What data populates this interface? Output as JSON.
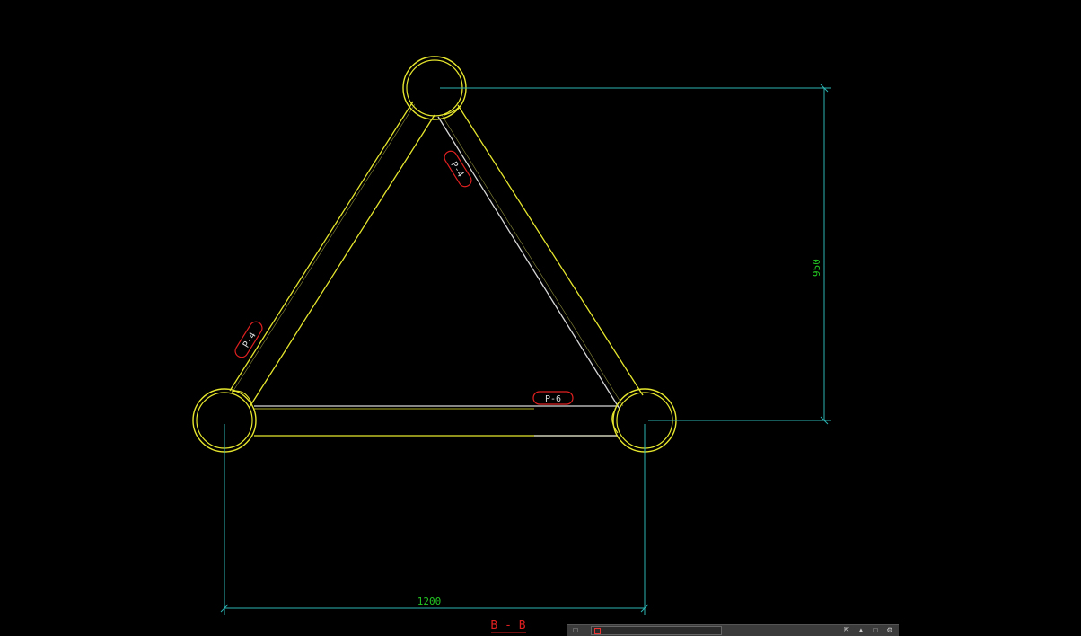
{
  "drawing": {
    "dimension_horizontal": "1200",
    "dimension_vertical": "950",
    "section_label": "B - B",
    "members": {
      "left_diagonal": "P-4",
      "right_diagonal": "P-4",
      "bottom_chord": "P-6"
    }
  },
  "colors": {
    "background": "#000000",
    "pipe_yellow": "#e6e62e",
    "pipe_white": "#d8d8d8",
    "dimension_cyan": "#2bb5b5",
    "dimension_text": "#23c423",
    "tag_red": "#e02020",
    "section_red": "#e02020"
  },
  "status_bar": {
    "model_label": "",
    "layer_label": "",
    "icons": [
      "model-icon",
      "layer-swatch-icon",
      "expand-icon",
      "up-arrow-icon",
      "square-icon",
      "gear-icon"
    ]
  }
}
